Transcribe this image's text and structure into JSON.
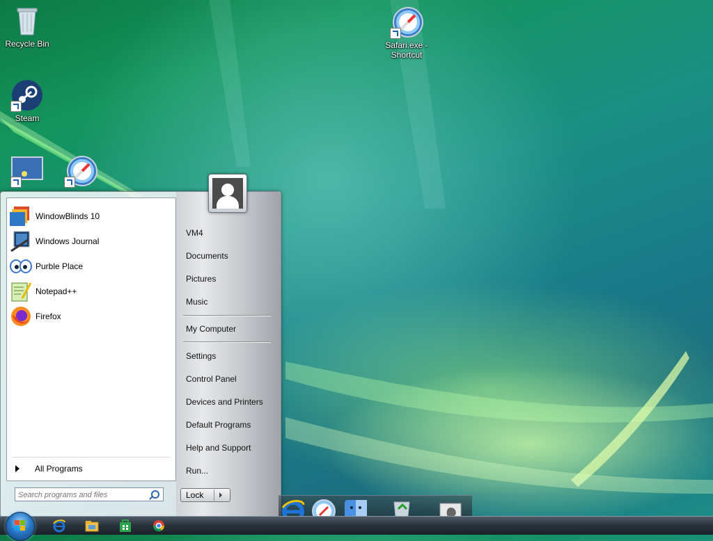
{
  "desktop": {
    "icons": [
      {
        "label": "Recycle Bin",
        "icon": "recycle-bin-icon"
      },
      {
        "label": "Steam",
        "icon": "steam-icon"
      },
      {
        "label": "Safari.exe - Shortcut",
        "icon": "safari-icon"
      }
    ]
  },
  "start_menu": {
    "pinned": [
      {
        "label": "WindowBlinds 10",
        "icon": "windowblinds-icon"
      },
      {
        "label": "Windows Journal",
        "icon": "windows-journal-icon"
      },
      {
        "label": "Purble Place",
        "icon": "purble-place-icon"
      },
      {
        "label": "Notepad++",
        "icon": "notepadpp-icon"
      },
      {
        "label": "Firefox",
        "icon": "firefox-icon"
      }
    ],
    "all_programs": "All Programs",
    "search_placeholder": "Search programs and files",
    "right_items": [
      "VM4",
      "Documents",
      "Pictures",
      "Music",
      "My Computer",
      "Settings",
      "Control Panel",
      "Devices and Printers",
      "Default Programs",
      "Help and Support",
      "Run..."
    ],
    "lock_label": "Lock"
  },
  "taskbar": {
    "icons": [
      "start-orb-icon",
      "internet-explorer-icon",
      "file-explorer-icon",
      "store-icon",
      "chrome-icon"
    ]
  },
  "dock": {
    "icons": [
      "internet-explorer-icon",
      "safari-icon",
      "finder-icon",
      "recycle-bin-icon",
      "apple-icon"
    ]
  },
  "colors": {
    "taskbar": "#2a343d",
    "accent": "#2a79c9"
  }
}
